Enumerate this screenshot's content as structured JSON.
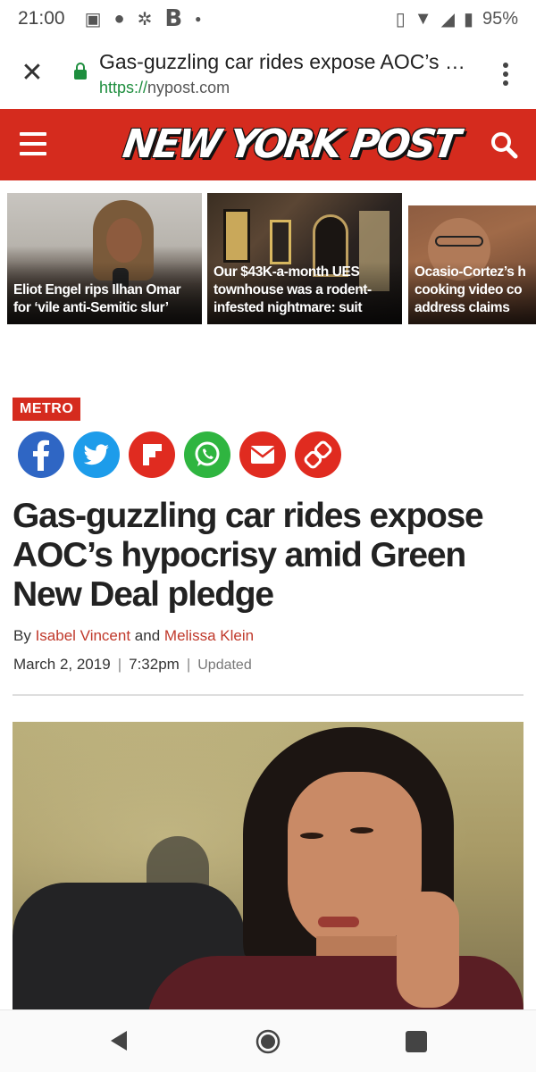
{
  "status_bar": {
    "time": "21:00",
    "notification_letter": "B",
    "battery": "95%"
  },
  "browser": {
    "page_title": "Gas-guzzling car rides expose AOC’s h…",
    "url_scheme": "https://",
    "url_host": "nypost.com",
    "icons": [
      "close-icon",
      "lock-icon",
      "overflow-menu-icon"
    ]
  },
  "site_header": {
    "logo_text": "NEW YORK POST",
    "brand_color": "#d52b1e"
  },
  "carousel": {
    "stories": [
      {
        "caption": "Eliot Engel rips Ilhan Omar for ‘vile anti-Semitic slur’"
      },
      {
        "caption": "Our $43K-a-month UES townhouse was a rodent-infested nightmare: suit"
      },
      {
        "caption": "Ocasio-Cortez’s h cooking video co address claims"
      }
    ]
  },
  "article": {
    "section": "METRO",
    "share_icons": [
      "facebook-icon",
      "twitter-icon",
      "flipboard-icon",
      "whatsapp-icon",
      "email-icon",
      "link-icon"
    ],
    "headline": "Gas-guzzling car rides expose AOC’s hypocrisy amid Green New Deal pledge",
    "byline": {
      "prefix": "By",
      "author1": "Isabel Vincent",
      "conjunction": "and",
      "author2": "Melissa Klein"
    },
    "date": "March 2, 2019",
    "time": "7:32pm",
    "updated_label": "Updated"
  },
  "nav_bar": {
    "icons": [
      "back-icon",
      "home-icon",
      "recents-icon"
    ]
  }
}
